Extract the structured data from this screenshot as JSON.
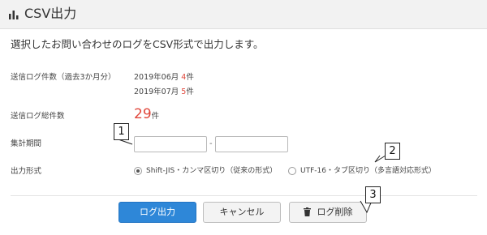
{
  "header": {
    "title": "CSV出力",
    "icon": "bar-chart-icon"
  },
  "description": "選択したお問い合わせのログをCSV形式で出力します。",
  "sent_logs": {
    "label": "送信ログ件数（過去3か月分）",
    "entries": [
      {
        "period": "2019年06月",
        "count": "4",
        "unit": "件"
      },
      {
        "period": "2019年07月",
        "count": "5",
        "unit": "件"
      }
    ]
  },
  "total": {
    "label": "送信ログ総件数",
    "count": "29",
    "unit": "件"
  },
  "period": {
    "label": "集計期間",
    "separator": "-",
    "from_value": "",
    "to_value": ""
  },
  "format": {
    "label": "出力形式",
    "options": [
      {
        "label": "Shift-JIS・カンマ区切り（従来の形式）",
        "selected": true
      },
      {
        "label": "UTF-16・タブ区切り（多言語対応形式）",
        "selected": false
      }
    ]
  },
  "buttons": {
    "export": "ログ出力",
    "cancel": "キャンセル",
    "delete": "ログ削除"
  },
  "callouts": [
    "1",
    "2",
    "3"
  ],
  "colors": {
    "primary": "#2e87d8",
    "highlight_red": "#e0463a",
    "header_bg": "#f2f2f2"
  }
}
